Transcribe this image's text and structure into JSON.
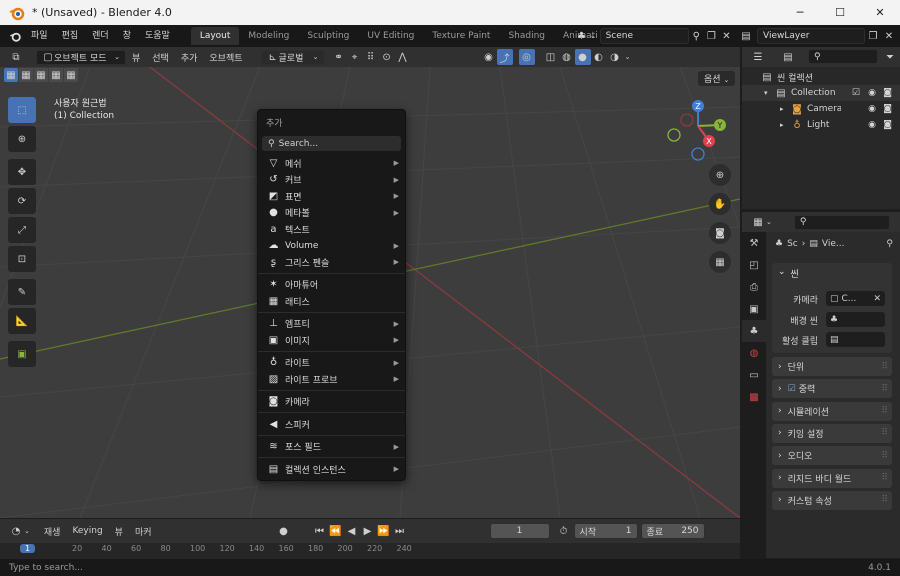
{
  "window": {
    "title": "* (Unsaved) - Blender 4.0",
    "min": "─",
    "max": "☐",
    "close": "✕"
  },
  "topbar": {
    "menus": [
      "파일",
      "편집",
      "렌더",
      "창",
      "도움말"
    ],
    "workspaces": [
      "Layout",
      "Modeling",
      "Sculpting",
      "UV Editing",
      "Texture Paint",
      "Shading",
      "Animati"
    ],
    "scene": "Scene",
    "view_layer": "ViewLayer"
  },
  "viewport_header": {
    "mode": "오브젝트 모드",
    "menus": [
      "뷰",
      "선택",
      "추가",
      "오브젝트"
    ],
    "orientation": "글로벌",
    "options": "옵션"
  },
  "viewport": {
    "view_name": "사용자 원근법",
    "collection": "(1) Collection",
    "gizmo_axes": {
      "x": "X",
      "y": "Y",
      "z": "Z"
    }
  },
  "add_menu": {
    "title": "추가",
    "search": "Search...",
    "groups": [
      [
        {
          "label": "메쉬",
          "icon": "▽",
          "sub": true
        },
        {
          "label": "커브",
          "icon": "↺",
          "sub": true
        },
        {
          "label": "표면",
          "icon": "◩",
          "sub": true
        },
        {
          "label": "메타볼",
          "icon": "●",
          "sub": true
        },
        {
          "label": "텍스트",
          "icon": "a",
          "sub": false
        },
        {
          "label": "Volume",
          "icon": "☁",
          "sub": true
        },
        {
          "label": "그리스 펜슬",
          "icon": "ʂ",
          "sub": true
        }
      ],
      [
        {
          "label": "아마튜어",
          "icon": "✶",
          "sub": false
        },
        {
          "label": "래티스",
          "icon": "▦",
          "sub": false
        }
      ],
      [
        {
          "label": "엠프티",
          "icon": "⊥",
          "sub": true
        },
        {
          "label": "이미지",
          "icon": "▣",
          "sub": true
        }
      ],
      [
        {
          "label": "라이트",
          "icon": "♁",
          "sub": true
        },
        {
          "label": "라이트 프로브",
          "icon": "▨",
          "sub": true
        }
      ],
      [
        {
          "label": "카메라",
          "icon": "◙",
          "sub": false
        }
      ],
      [
        {
          "label": "스피커",
          "icon": "◀",
          "sub": false
        }
      ],
      [
        {
          "label": "포스 필드",
          "icon": "≋",
          "sub": true
        }
      ],
      [
        {
          "label": "컬렉션 인스턴스",
          "icon": "▤",
          "sub": true
        }
      ]
    ]
  },
  "timeline": {
    "menus": [
      "재생",
      "Keying",
      "뷰",
      "마커"
    ],
    "current_frame": "1",
    "start_label": "시작",
    "start": "1",
    "end_label": "종료",
    "end": "250",
    "ruler": [
      "1",
      "20",
      "40",
      "60",
      "80",
      "100",
      "120",
      "140",
      "160",
      "180",
      "200",
      "220",
      "240"
    ]
  },
  "status": {
    "hint": "Type to search...",
    "version": "4.0.1"
  },
  "outliner": {
    "root": "씬 컬렉션",
    "items": [
      {
        "label": "Collection",
        "icon": "▤",
        "level": 1
      },
      {
        "label": "Camera",
        "icon": "◙",
        "level": 2
      },
      {
        "label": "Light",
        "icon": "♁",
        "level": 2
      }
    ]
  },
  "properties": {
    "breadcrumb": [
      "Sc",
      "Vie..."
    ],
    "panel_title": "씬",
    "camera_label": "카메라",
    "camera_value": "C...",
    "background_label": "배경 씬",
    "clip_label": "활성 클립",
    "sections": [
      "단위",
      "중력",
      "시뮬레이션",
      "키잉 설정",
      "오디오",
      "리지드 바디 월드",
      "커스텀 속성"
    ]
  },
  "colors": {
    "accent": "#4772b3",
    "x_axis": "#e0404f",
    "y_axis": "#8ab43a",
    "z_axis": "#3f7ed6"
  }
}
